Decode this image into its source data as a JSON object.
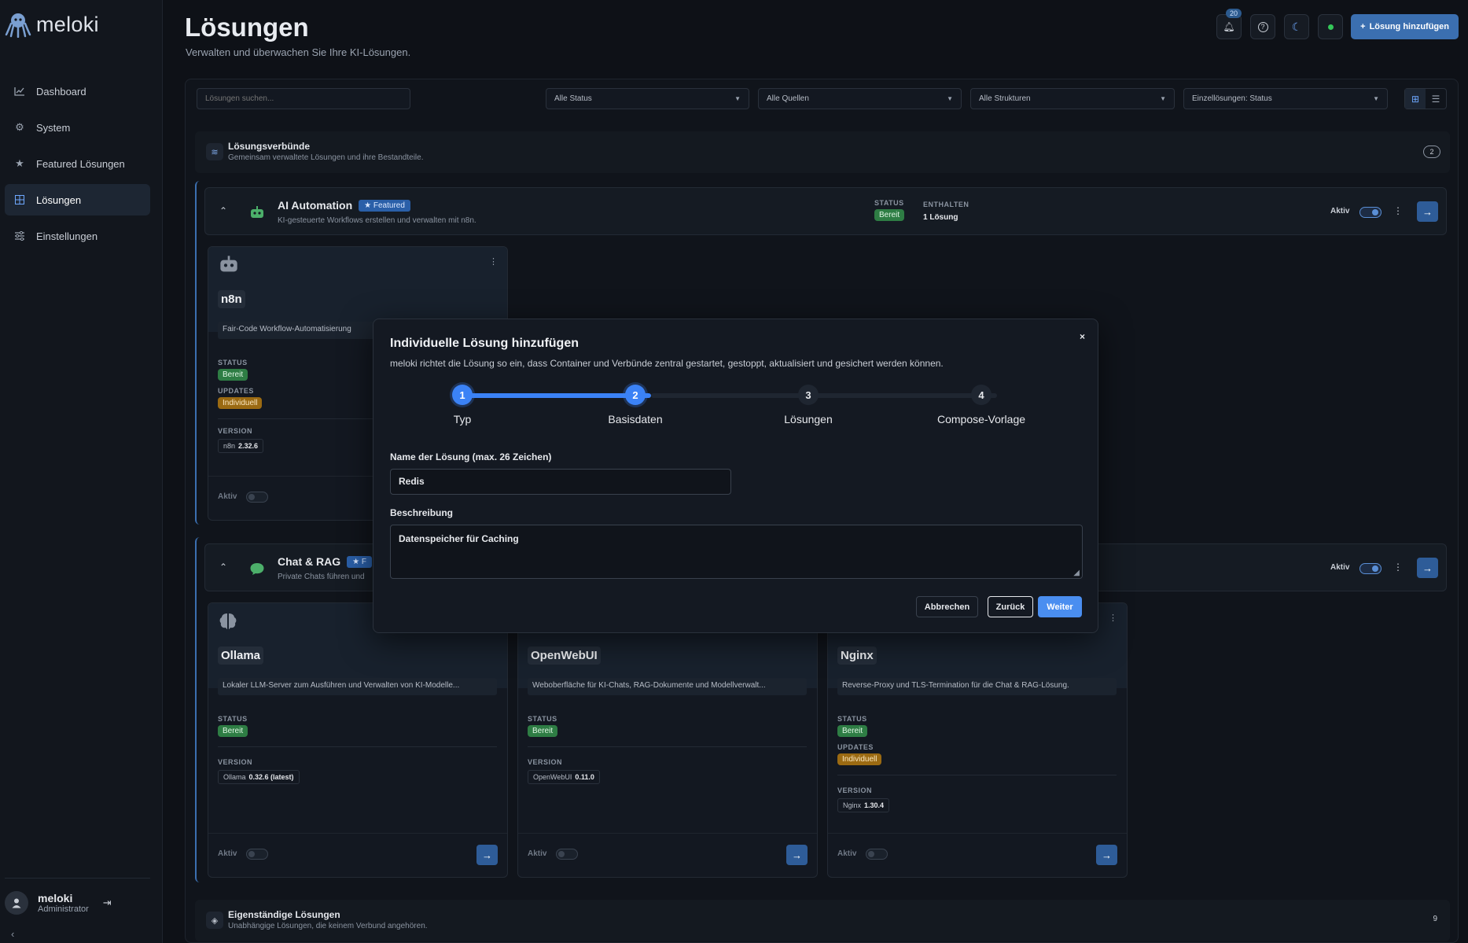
{
  "app": {
    "name": "meloki"
  },
  "sidebar": {
    "items": [
      {
        "label": "Dashboard",
        "icon": "chart-line-icon"
      },
      {
        "label": "System",
        "icon": "gear-icon"
      },
      {
        "label": "Featured Lösungen",
        "icon": "star-icon"
      },
      {
        "label": "Lösungen",
        "icon": "grid-icon",
        "active": true
      },
      {
        "label": "Einstellungen",
        "icon": "sliders-icon"
      }
    ],
    "user": {
      "name": "meloki",
      "role": "Administrator"
    }
  },
  "header": {
    "title": "Lösungen",
    "subtitle": "Verwalten und überwachen Sie Ihre KI-Lösungen.",
    "notification_count": "20",
    "add_button": "Lösung hinzufügen"
  },
  "filters": {
    "search_placeholder": "Lösungen suchen...",
    "status": "Alle Status",
    "sources": "Alle Quellen",
    "structures": "Alle Strukturen",
    "single": "Einzellösungen: Status"
  },
  "sections": {
    "composites": {
      "title": "Lösungsverbünde",
      "desc": "Gemeinsam verwaltete Lösungen und ihre Bestandteile.",
      "count": "2"
    },
    "standalone": {
      "title": "Eigenständige Lösungen",
      "desc": "Unabhängige Lösungen, die keinem Verbund angehören.",
      "count": "9"
    }
  },
  "groups": {
    "ai": {
      "title": "AI Automation",
      "featured": "Featured",
      "desc": "KI-gesteuerte Workflows erstellen und verwalten mit n8n.",
      "status_label": "STATUS",
      "status": "Bereit",
      "contains_label": "ENTHALTEN",
      "contains": "1 Lösung",
      "aktiv": "Aktiv"
    },
    "chat": {
      "title": "Chat & RAG",
      "featured": "F",
      "desc": "Private Chats führen und",
      "aktiv": "Aktiv"
    }
  },
  "cards": {
    "n8n": {
      "name": "n8n",
      "desc": "Fair-Code Workflow-Automatisierung",
      "status_label": "STATUS",
      "status": "Bereit",
      "updates_label": "UPDATES",
      "updates": "Individuell",
      "version_label": "VERSION",
      "version_name": "n8n",
      "version": "2.32.6",
      "aktiv": "Aktiv"
    },
    "ollama": {
      "name": "Ollama",
      "desc": "Lokaler LLM-Server zum Ausführen und Verwalten von KI-Modelle...",
      "status_label": "STATUS",
      "status": "Bereit",
      "version_label": "VERSION",
      "version_name": "Ollama",
      "version": "0.32.6 (latest)",
      "aktiv": "Aktiv"
    },
    "openwebui": {
      "name": "OpenWebUI",
      "desc": "Weboberfläche für KI-Chats, RAG-Dokumente und Modellverwalt...",
      "status_label": "STATUS",
      "status": "Bereit",
      "version_label": "VERSION",
      "version_name": "OpenWebUI",
      "version": "0.11.0",
      "aktiv": "Aktiv"
    },
    "nginx": {
      "name": "Nginx",
      "desc": "Reverse-Proxy und TLS-Termination für die Chat & RAG-Lösung.",
      "status_label": "STATUS",
      "status": "Bereit",
      "updates_label": "UPDATES",
      "updates": "Individuell",
      "version_label": "VERSION",
      "version_name": "Nginx",
      "version": "1.30.4",
      "aktiv": "Aktiv"
    }
  },
  "modal": {
    "title": "Individuelle Lösung hinzufügen",
    "subtitle": "meloki richtet die Lösung so ein, dass Container und Verbünde zentral gestartet, gestoppt, aktualisiert und gesichert werden können.",
    "close": "×",
    "current_step": 2,
    "steps": [
      {
        "num": "1",
        "label": "Typ"
      },
      {
        "num": "2",
        "label": "Basisdaten"
      },
      {
        "num": "3",
        "label": "Lösungen"
      },
      {
        "num": "4",
        "label": "Compose-Vorlage"
      }
    ],
    "name_label": "Name der Lösung (max. 26 Zeichen)",
    "name_value": "Redis",
    "desc_label": "Beschreibung",
    "desc_value": "Datenspeicher für Caching",
    "cancel": "Abbrechen",
    "back": "Zurück",
    "next": "Weiter"
  },
  "colors": {
    "accent": "#3b82f6",
    "success": "#2e7d44",
    "warning": "#9b6a12",
    "background": "#0e1117"
  }
}
